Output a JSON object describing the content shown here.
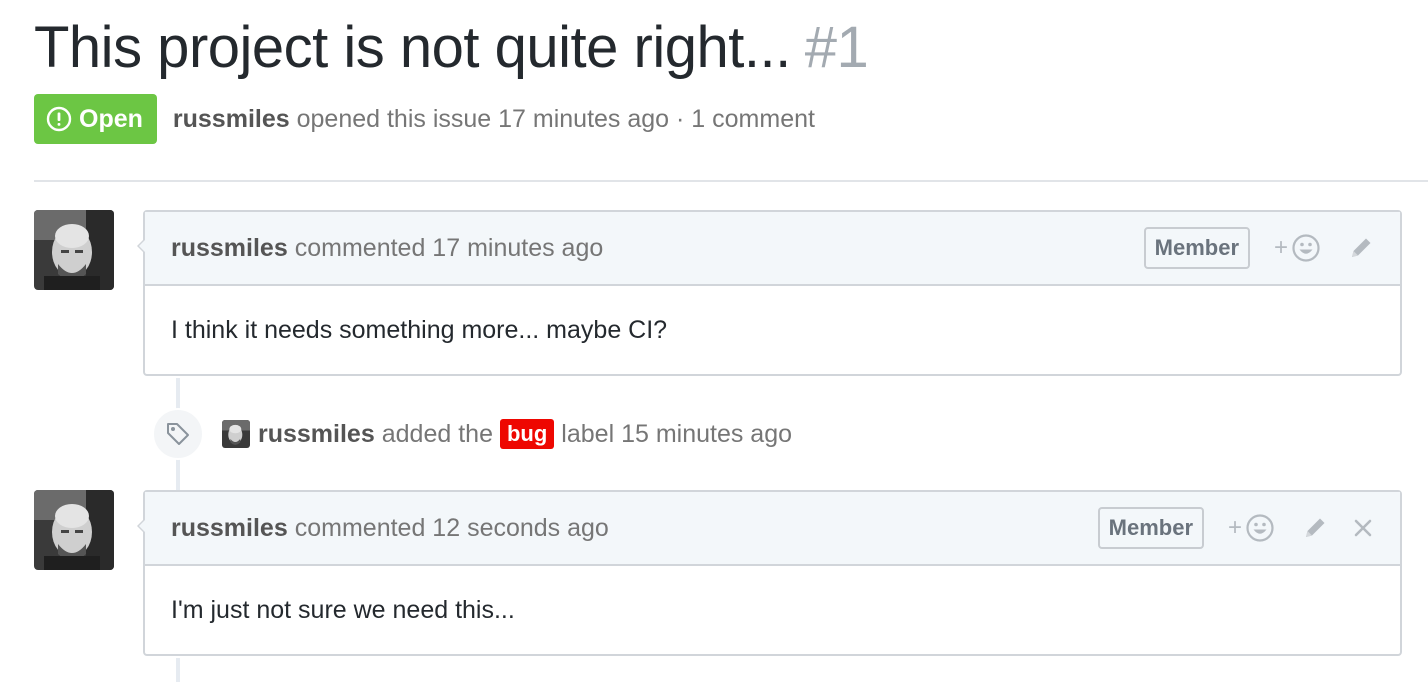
{
  "issue": {
    "title": "This project is not quite right...",
    "number": "#1",
    "state": "Open",
    "author": "russmiles",
    "opened_text": "opened this issue 17 minutes ago · 1 comment"
  },
  "comments": [
    {
      "author": "russmiles",
      "action": "commented 17 minutes ago",
      "role": "Member",
      "body": "I think it needs something more... maybe CI?",
      "reaction_label": "+"
    },
    {
      "author": "russmiles",
      "action": "commented 12 seconds ago",
      "role": "Member",
      "body": "I'm just not sure we need this...",
      "reaction_label": "+"
    }
  ],
  "event": {
    "author": "russmiles",
    "prefix": "added the",
    "label": "bug",
    "suffix": "label 15 minutes ago"
  },
  "colors": {
    "open_badge": "#6cc644",
    "bug_label": "#ee0701",
    "header_bg": "#f3f7fa"
  },
  "icons": {
    "state": "issue-opened-icon",
    "event": "tag-icon",
    "reaction": "smiley-icon",
    "edit": "pencil-icon",
    "delete": "close-icon"
  }
}
